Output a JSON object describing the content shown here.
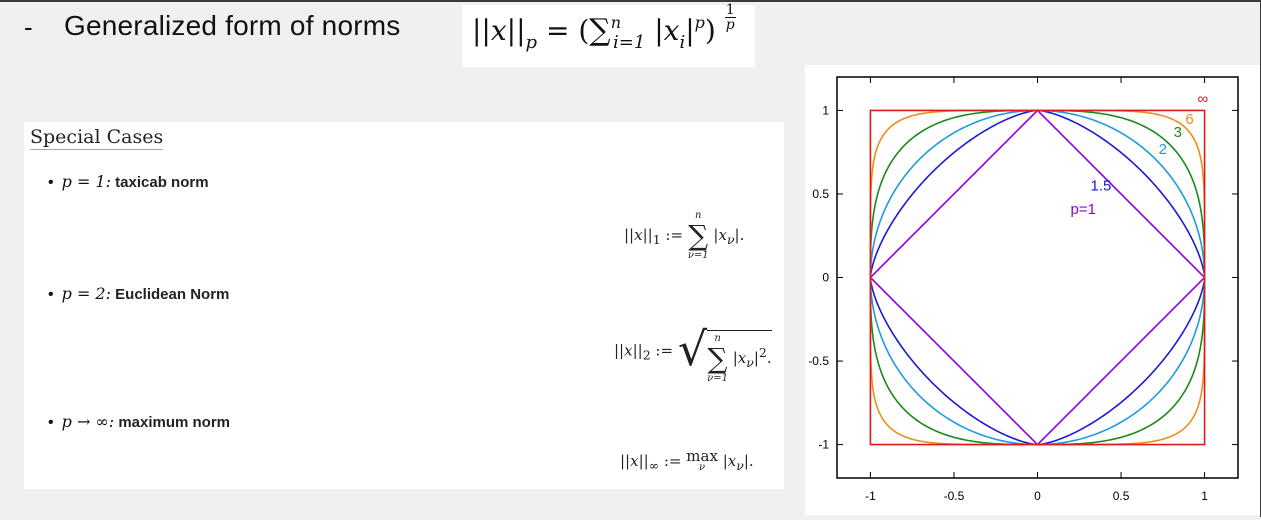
{
  "slide": {
    "bullet": "-",
    "heading": "Generalized form of norms"
  },
  "formula": {
    "norm": "||x||",
    "sub_p": "p",
    "eq": "= (",
    "sigma": "∑",
    "sum_lower": "i=1",
    "sum_upper": "n",
    "abs_open": "|x",
    "sub_i": "i",
    "abs_close": "|",
    "pow_p": "p",
    "close": ")",
    "exp_num": "1",
    "exp_den": "p"
  },
  "special_cases": {
    "title": "Special Cases",
    "items": [
      {
        "bullet": "•",
        "condition": "p = 1:",
        "name": "taxicab norm",
        "formula_lhs": "||x||",
        "formula_sub": "1",
        "formula_assign": " := ",
        "sum_upper": "n",
        "sum_lower": "ν=1",
        "term": "|x",
        "term_sub": "ν",
        "term_end": "|."
      },
      {
        "bullet": "•",
        "condition": "p = 2:",
        "name": "Euclidean Norm",
        "formula_lhs": "||x||",
        "formula_sub": "2",
        "formula_assign": " := ",
        "sum_upper": "n",
        "sum_lower": "ν=1",
        "term": "|x",
        "term_sub": "ν",
        "term_end": "|",
        "term_pow": "2",
        "term_tail": "."
      },
      {
        "bullet": "•",
        "condition": "p → ∞:",
        "name": "maximum norm",
        "formula_lhs": "||x||",
        "formula_sub": "∞",
        "formula_assign": " := ",
        "max_op": "max",
        "max_sub": "ν",
        "term": "|x",
        "term_sub": "ν",
        "term_end": "|."
      }
    ]
  },
  "chart_data": {
    "type": "line",
    "title": "",
    "xlabel": "",
    "ylabel": "",
    "xlim": [
      -1.2,
      1.2
    ],
    "ylim": [
      -1.2,
      1.2
    ],
    "x_ticks": [
      "-1",
      "-0.5",
      "0",
      "0.5",
      "1"
    ],
    "y_ticks": [
      "1",
      "0.5",
      "0",
      "-0.5",
      "-1"
    ],
    "x_tick_values": [
      -1,
      -0.5,
      0,
      0.5,
      1
    ],
    "y_tick_values": [
      1,
      0.5,
      0,
      -0.5,
      -1
    ],
    "grid": false,
    "series": [
      {
        "name": "p=1",
        "p": 1,
        "color": "#9400d3"
      },
      {
        "name": "1.5",
        "p": 1.5,
        "color": "#1a1ad6"
      },
      {
        "name": "2",
        "p": 2,
        "color": "#1e9be0"
      },
      {
        "name": "3",
        "p": 3,
        "color": "#1a8a1a"
      },
      {
        "name": "6",
        "p": 6,
        "color": "#f08c1c"
      },
      {
        "name": "∞",
        "p": "inf",
        "color": "#e01a1a"
      }
    ],
    "curve_labels_on_chart": true
  }
}
